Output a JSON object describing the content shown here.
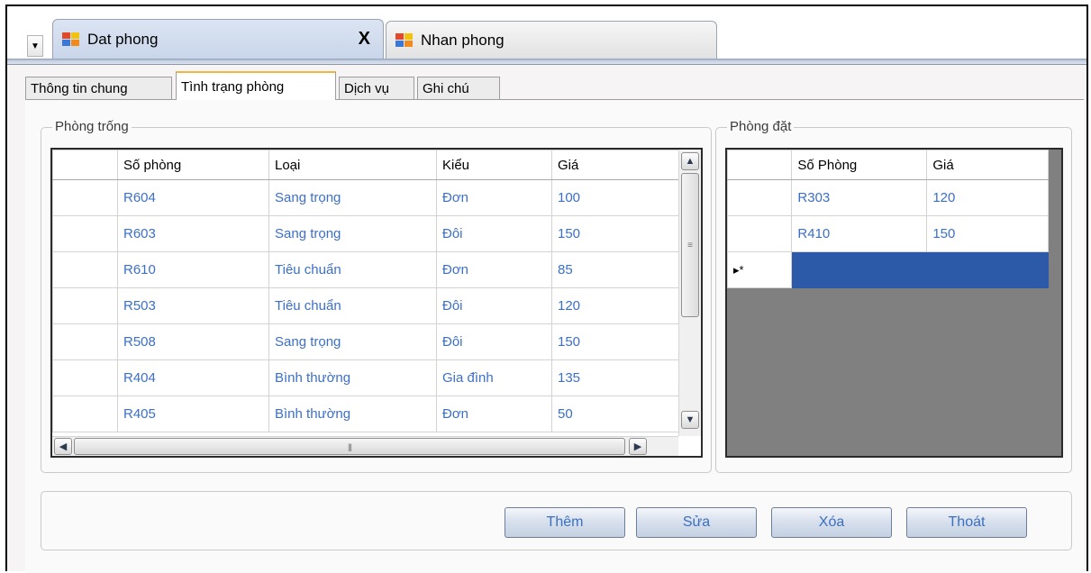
{
  "doc_tabs": [
    {
      "label": "Dat phong",
      "close": "X"
    },
    {
      "label": "Nhan phong"
    }
  ],
  "sub_tabs": [
    "Thông tin chung",
    "Tình trạng phòng",
    "Dịch vụ",
    "Ghi chú"
  ],
  "empty_rooms": {
    "title": "Phòng trống",
    "columns": [
      "Số phòng",
      "Loại",
      "Kiểu",
      "Giá"
    ],
    "rows": [
      [
        "R604",
        "Sang trọng",
        "Đơn",
        "100"
      ],
      [
        "R603",
        "Sang trọng",
        "Đôi",
        "150"
      ],
      [
        "R610",
        "Tiêu chuẩn",
        "Đơn",
        "85"
      ],
      [
        "R503",
        "Tiêu chuẩn",
        "Đôi",
        "120"
      ],
      [
        "R508",
        "Sang trọng",
        "Đôi",
        "150"
      ],
      [
        "R404",
        "Bình thường",
        "Gia đình",
        "135"
      ],
      [
        "R405",
        "Bình thường",
        "Đơn",
        "50"
      ]
    ]
  },
  "booked_rooms": {
    "title": "Phòng đặt",
    "columns": [
      "Số Phòng",
      "Giá"
    ],
    "rows": [
      [
        "R303",
        "120"
      ],
      [
        "R410",
        "150"
      ]
    ],
    "new_row_marker": "▸*"
  },
  "buttons": {
    "add": "Thêm",
    "edit": "Sửa",
    "delete": "Xóa",
    "exit": "Thoát"
  },
  "colors": {
    "cell_text": "#3c6fc6",
    "selection": "#2d5aa8",
    "empty_grid": "#808080"
  }
}
